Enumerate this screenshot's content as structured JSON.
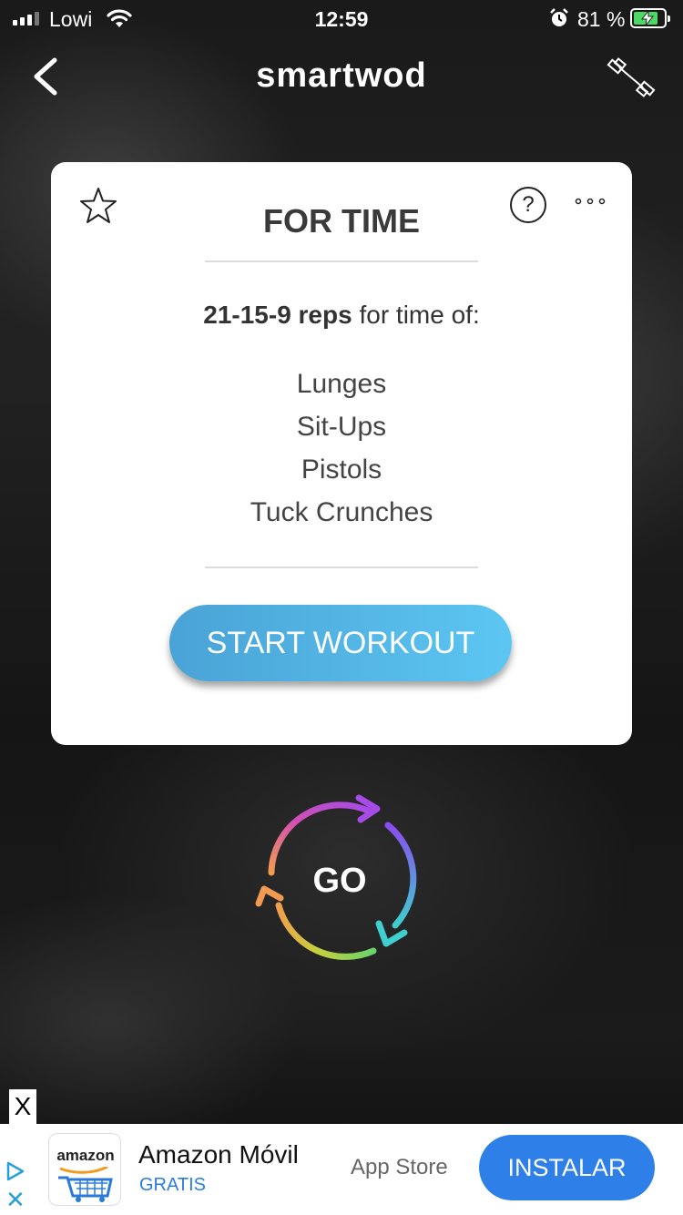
{
  "status_bar": {
    "carrier": "Lowi",
    "time": "12:59",
    "battery_percent": "81 %",
    "battery_level": 0.81,
    "charging": true
  },
  "nav": {
    "title": "smartwod",
    "back_icon": "chevron-left-icon",
    "action_icon": "dumbbell-icon"
  },
  "workout": {
    "type": "FOR TIME",
    "reps_scheme": "21-15-9 reps",
    "description_suffix": " for time of:",
    "movements": [
      "Lunges",
      "Sit-Ups",
      "Pistols",
      "Tuck Crunches"
    ],
    "start_label": "START WORKOUT",
    "colors": {
      "start_gradient_from": "#4aa3d6",
      "start_gradient_to": "#5cc6f2"
    }
  },
  "go_button": {
    "label": "GO",
    "ring_colors": [
      "#a64be8",
      "#d24fb4",
      "#f29b50",
      "#8cd14a",
      "#3ecfcf",
      "#5a6df0"
    ]
  },
  "ad": {
    "close_label": "X",
    "logo_text": "amazon",
    "app_name": "Amazon Móvil",
    "price": "GRATIS",
    "store": "App Store",
    "install_label": "INSTALAR",
    "adchoices_close": "✕",
    "accent": "#2f7fe8"
  }
}
